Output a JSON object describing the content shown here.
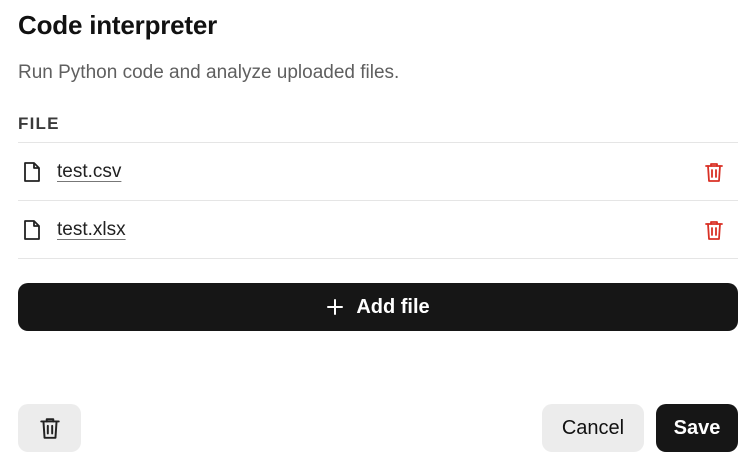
{
  "header": {
    "title": "Code interpreter",
    "subtitle": "Run Python code and analyze uploaded files."
  },
  "files": {
    "section_label": "FILE",
    "items": [
      {
        "name": "test.csv",
        "icon": "file-icon",
        "delete_icon": "trash-icon"
      },
      {
        "name": "test.xlsx",
        "icon": "file-icon",
        "delete_icon": "trash-icon"
      }
    ]
  },
  "actions": {
    "add_file_label": "Add file",
    "add_file_icon": "plus-icon",
    "delete_tool_icon": "trash-icon",
    "cancel_label": "Cancel",
    "save_label": "Save"
  },
  "colors": {
    "primary_button": "#161616",
    "secondary_button": "#ececec",
    "danger": "#d93025",
    "divider": "#e5e5e5"
  }
}
